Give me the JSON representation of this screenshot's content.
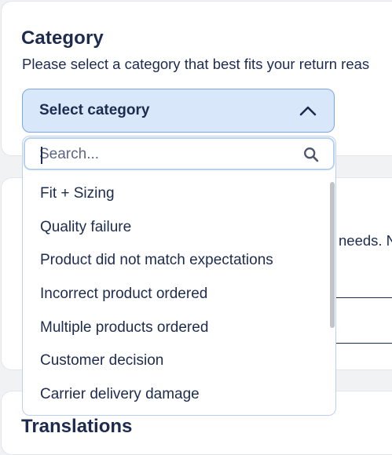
{
  "category": {
    "title": "Category",
    "description": "Please select a category that best fits your return reas",
    "select_label": "Select category"
  },
  "dropdown": {
    "search_placeholder": "Search...",
    "options": [
      "Fit + Sizing",
      "Quality failure",
      "Product did not match expectations",
      "Incorrect product ordered",
      "Multiple products ordered",
      "Customer decision",
      "Carrier delivery damage"
    ]
  },
  "background_section": {
    "partial_text": "needs. N"
  },
  "translations": {
    "title": "Translations"
  },
  "icons": {
    "chevron": "chevron-up-icon",
    "search": "search-icon"
  },
  "colors": {
    "trigger_bg": "#d9e7fb",
    "trigger_border": "#7aa6e8",
    "text": "#1d2b4f"
  }
}
